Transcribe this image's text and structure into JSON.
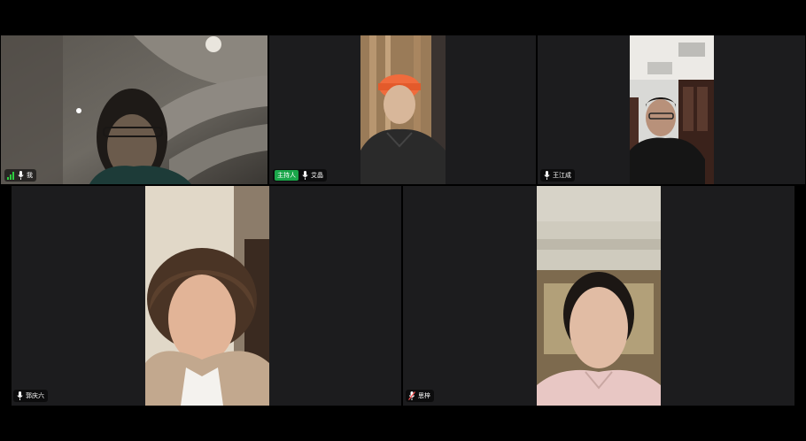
{
  "participants": [
    {
      "name": "我",
      "host": false,
      "muted": false,
      "signal": true
    },
    {
      "name": "艾晶",
      "host": true,
      "host_label": "主持人",
      "muted": false
    },
    {
      "name": "王江成",
      "host": false,
      "muted": false
    },
    {
      "name": "郭庆六",
      "host": false,
      "muted": false
    },
    {
      "name": "思梓",
      "host": false,
      "muted": true
    },
    {
      "name": "",
      "host": false,
      "muted": false
    }
  ],
  "icons": {
    "mic": "microphone-icon",
    "mic_muted": "microphone-muted-icon",
    "signal": "signal-bars-icon"
  },
  "colors": {
    "tile_bg": "#1c1c1e",
    "host_badge": "#1aa64a",
    "signal": "#2ecc40"
  }
}
